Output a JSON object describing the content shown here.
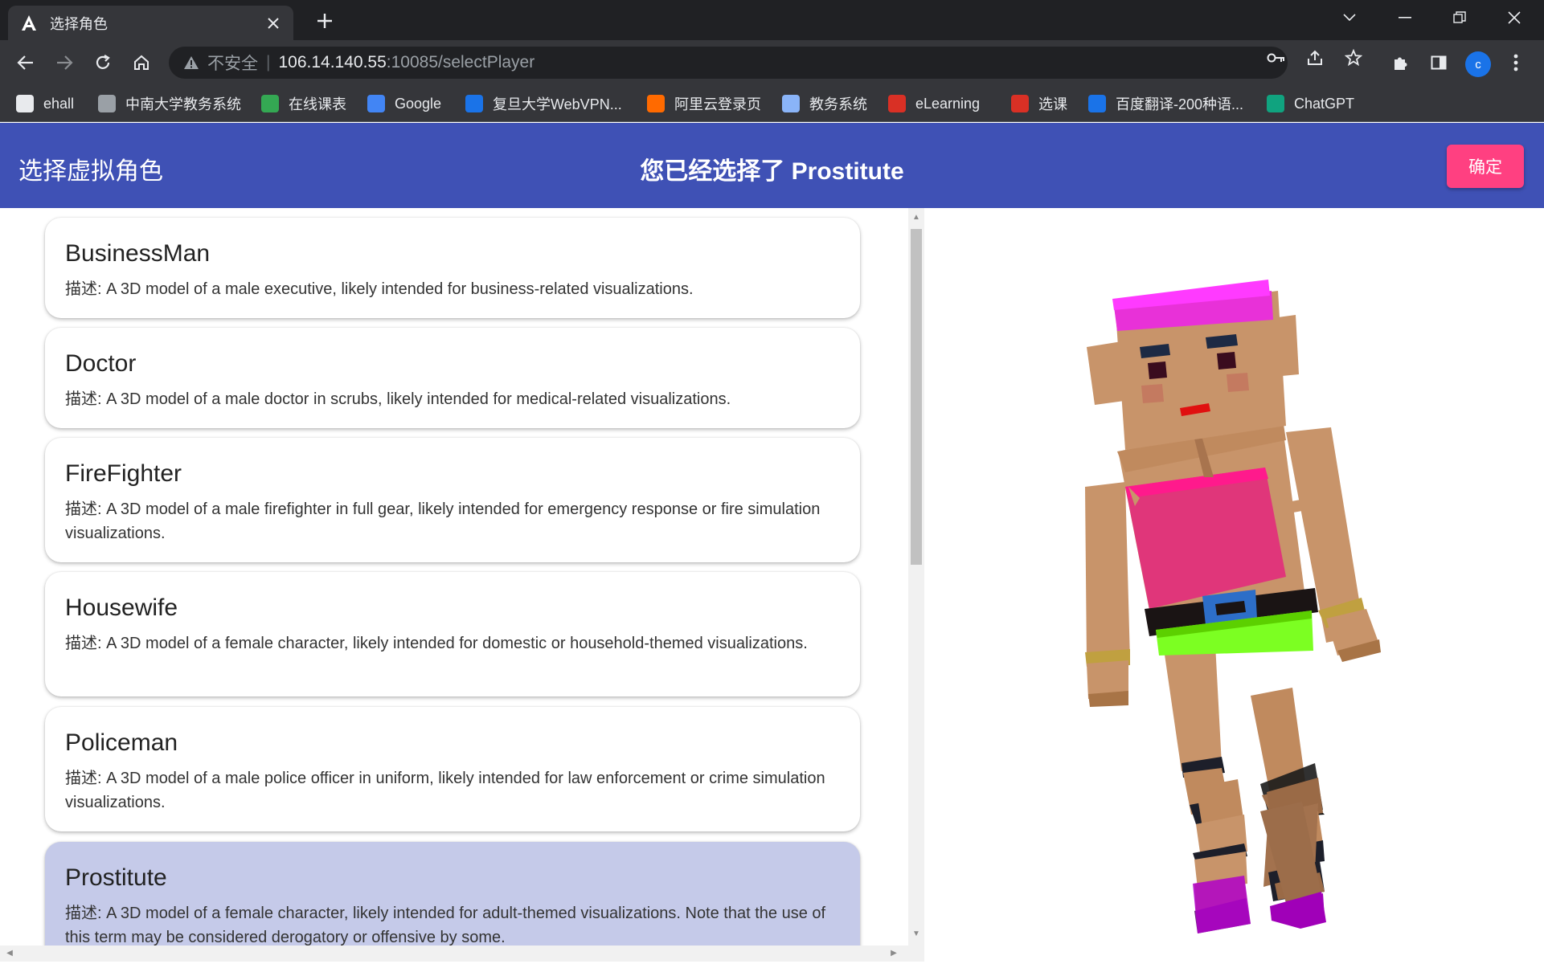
{
  "browser": {
    "tab_title": "选择角色",
    "security_label": "不安全",
    "url_host": "106.14.140.55",
    "url_path": ":10085/selectPlayer",
    "avatar_letter": "c",
    "bookmarks": [
      {
        "label": "ehall",
        "icon": "home-icon",
        "color": "#e8eaed"
      },
      {
        "label": "中南大学教务系统",
        "icon": "globe-icon",
        "color": "#9aa0a6"
      },
      {
        "label": "在线课表",
        "icon": "leaf-icon",
        "color": "#34a853"
      },
      {
        "label": "Google",
        "icon": "google-icon",
        "color": "#4285f4"
      },
      {
        "label": "复旦大学WebVPN...",
        "icon": "fudan-icon",
        "color": "#1a73e8"
      },
      {
        "label": "阿里云登录页",
        "icon": "aliyun-icon",
        "color": "#ff6a00"
      },
      {
        "label": "教务系统",
        "icon": "seal-icon",
        "color": "#8ab4f8"
      },
      {
        "label": "eLearning",
        "icon": "gear-icon",
        "color": "#d93025"
      },
      {
        "label": "选课",
        "icon": "p-icon",
        "color": "#d93025"
      },
      {
        "label": "百度翻译-200种语...",
        "icon": "translate-icon",
        "color": "#1a73e8"
      },
      {
        "label": "ChatGPT",
        "icon": "chatgpt-icon",
        "color": "#10a37f"
      }
    ]
  },
  "app": {
    "header_title": "选择虚拟角色",
    "selected_text": "您已经选择了 Prostitute",
    "confirm_label": "确定",
    "accent": "#3f51b5",
    "confirm_color": "#ff4081",
    "selected_card_color": "#c5cae9"
  },
  "players": [
    {
      "name": "BusinessMan",
      "desc": "描述: A 3D model of a male executive, likely intended for business-related visualizations."
    },
    {
      "name": "Doctor",
      "desc": "描述: A 3D model of a male doctor in scrubs, likely intended for medical-related visualizations."
    },
    {
      "name": "FireFighter",
      "desc": "描述: A 3D model of a male firefighter in full gear, likely intended for emergency response or fire simulation visualizations."
    },
    {
      "name": "Housewife",
      "desc": "描述: A 3D model of a female character, likely intended for domestic or household-themed visualizations."
    },
    {
      "name": "Policeman",
      "desc": "描述: A 3D model of a male police officer in uniform, likely intended for law enforcement or crime simulation visualizations."
    },
    {
      "name": "Prostitute",
      "desc": "描述: A 3D model of a female character, likely intended for adult-themed visualizations. Note that the use of this term may be considered derogatory or offensive by some."
    }
  ],
  "selected_index": 5
}
